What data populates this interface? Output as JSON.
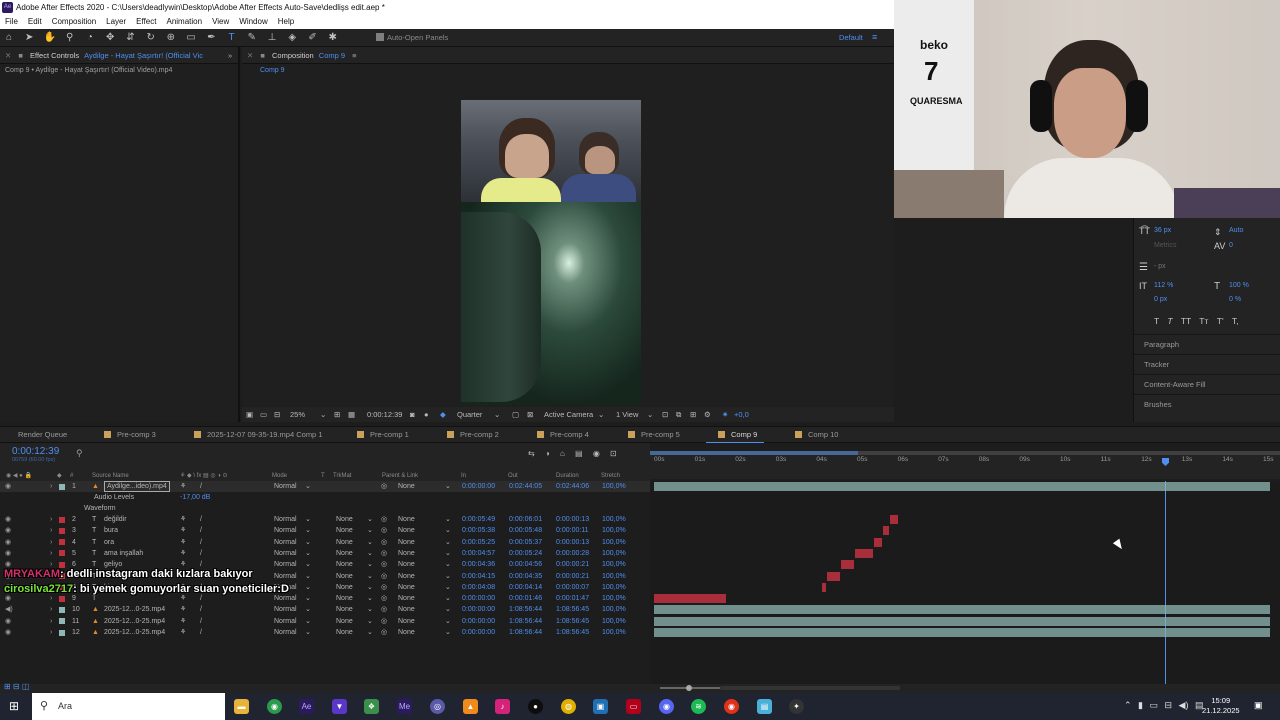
{
  "window": {
    "title": "Adobe After Effects 2020 - C:\\Users\\deadlywin\\Desktop\\Adobe After Effects Auto-Save\\dedlişs edit.aep *"
  },
  "menu": [
    "File",
    "Edit",
    "Composition",
    "Layer",
    "Effect",
    "Animation",
    "View",
    "Window",
    "Help"
  ],
  "toolbar": {
    "auto_open_panels": "Auto-Open Panels",
    "workspace": "Default"
  },
  "effect_controls": {
    "tab_label": "Effect Controls",
    "tab_target": "Aydilge - Hayat Şaşırtır! (Official Vic",
    "subtitle": "Comp 9 • Aydilge - Hayat Şaşırtır! (Official Video).mp4"
  },
  "composition_panel": {
    "tab_label": "Composition",
    "tab_target": "Comp 9",
    "breadcrumb": "Comp 9",
    "zoom": "25%",
    "timecode": "0:00:12:39",
    "resolution": "Quarter",
    "camera": "Active Camera",
    "view": "1 View",
    "exposure": "+0,0"
  },
  "character_panel": {
    "font_size": "36 px",
    "leading": "Auto",
    "kerning": "Metrics",
    "tracking": "0",
    "stroke_width": "- px",
    "vert_scale": "112 %",
    "horiz_scale": "100 %",
    "baseline": "0 px",
    "tsume": "0 %",
    "style_buttons": [
      "T",
      "T",
      "TT",
      "Tт",
      "T'",
      "T,"
    ]
  },
  "side_sections": [
    "Paragraph",
    "Tracker",
    "Content-Aware Fill",
    "Brushes"
  ],
  "timeline_tabs": [
    {
      "label": "Render Queue",
      "color": "#232323"
    },
    {
      "label": "Pre-comp 3",
      "color": "#c9a15a"
    },
    {
      "label": "2025-12-07 09-35-19.mp4 Comp 1",
      "color": "#c9a15a"
    },
    {
      "label": "Pre-comp 1",
      "color": "#c9a15a"
    },
    {
      "label": "Pre-comp 2",
      "color": "#c9a15a"
    },
    {
      "label": "Pre-comp 4",
      "color": "#c9a15a"
    },
    {
      "label": "Pre-comp 5",
      "color": "#c9a15a"
    },
    {
      "label": "Comp 9",
      "color": "#c9a15a"
    },
    {
      "label": "Comp 10",
      "color": "#c9a15a"
    }
  ],
  "timeline": {
    "timecode": "0:00:12:39",
    "timecode_sub": "00759 (60.00 fps)",
    "columns": {
      "num": "#",
      "source_name": "Source Name",
      "mode": "Mode",
      "t": "T",
      "trkmat": "TrkMat",
      "parent": "Parent & Link",
      "in": "In",
      "out": "Out",
      "duration": "Duration",
      "stretch": "Stretch"
    },
    "ruler_labels": [
      "00s",
      "01s",
      "02s",
      "03s",
      "04s",
      "05s",
      "06s",
      "07s",
      "08s",
      "09s",
      "10s",
      "11s",
      "12s",
      "13s",
      "14s",
      "15s"
    ],
    "audio_levels_label": "Audio Levels",
    "audio_levels_value": "-17,00 dB",
    "waveform_label": "Waveform",
    "layers": [
      {
        "num": "1",
        "name": "Aydilge...ideo).mp4",
        "mode": "Normal",
        "trkmat": "",
        "parent": "None",
        "in": "0:00:00:00",
        "out": "0:02:44:05",
        "dur": "0:02:44:06",
        "stretch": "100,0%",
        "color": "#8fb8b4",
        "type": "video"
      },
      {
        "num": "2",
        "name": "değildir",
        "mode": "Normal",
        "trkmat": "None",
        "parent": "None",
        "in": "0:00:05:49",
        "out": "0:00:06:01",
        "dur": "0:00:00:13",
        "stretch": "100,0%",
        "color": "#c0313f",
        "type": "text"
      },
      {
        "num": "3",
        "name": "bura",
        "mode": "Normal",
        "trkmat": "None",
        "parent": "None",
        "in": "0:00:05:38",
        "out": "0:00:05:48",
        "dur": "0:00:00:11",
        "stretch": "100,0%",
        "color": "#c0313f",
        "type": "text"
      },
      {
        "num": "4",
        "name": "ora",
        "mode": "Normal",
        "trkmat": "None",
        "parent": "None",
        "in": "0:00:05:25",
        "out": "0:00:05:37",
        "dur": "0:00:00:13",
        "stretch": "100,0%",
        "color": "#c0313f",
        "type": "text"
      },
      {
        "num": "5",
        "name": "ama inşallah",
        "mode": "Normal",
        "trkmat": "None",
        "parent": "None",
        "in": "0:00:04:57",
        "out": "0:00:05:24",
        "dur": "0:00:00:28",
        "stretch": "100,0%",
        "color": "#c0313f",
        "type": "text"
      },
      {
        "num": "6",
        "name": "geliyo",
        "mode": "Normal",
        "trkmat": "None",
        "parent": "None",
        "in": "0:00:04:36",
        "out": "0:00:04:56",
        "dur": "0:00:00:21",
        "stretch": "100,0%",
        "color": "#c0313f",
        "type": "text"
      },
      {
        "num": "7",
        "name": "",
        "mode": "Normal",
        "trkmat": "None",
        "parent": "None",
        "in": "0:00:04:15",
        "out": "0:00:04:35",
        "dur": "0:00:00:21",
        "stretch": "100,0%",
        "color": "#c0313f",
        "type": "text"
      },
      {
        "num": "8",
        "name": "bir",
        "mode": "Normal",
        "trkmat": "None",
        "parent": "None",
        "in": "0:00:04:08",
        "out": "0:00:04:14",
        "dur": "0:00:00:07",
        "stretch": "100,0%",
        "color": "#c0313f",
        "type": "text"
      },
      {
        "num": "9",
        "name": "",
        "mode": "Normal",
        "trkmat": "None",
        "parent": "None",
        "in": "0:00:00:00",
        "out": "0:00:01:46",
        "dur": "0:00:01:47",
        "stretch": "100,0%",
        "color": "#c0313f",
        "type": "text"
      },
      {
        "num": "10",
        "name": "2025-12...0-25.mp4",
        "mode": "Normal",
        "trkmat": "None",
        "parent": "None",
        "in": "0:00:00:00",
        "out": "1:08:56:44",
        "dur": "1:08:56:45",
        "stretch": "100,0%",
        "color": "#8fb8b4",
        "type": "audio"
      },
      {
        "num": "11",
        "name": "2025-12...0-25.mp4",
        "mode": "Normal",
        "trkmat": "None",
        "parent": "None",
        "in": "0:00:00:00",
        "out": "1:08:56:44",
        "dur": "1:08:56:45",
        "stretch": "100,0%",
        "color": "#8fb8b4",
        "type": "video"
      },
      {
        "num": "12",
        "name": "2025-12...0-25.mp4",
        "mode": "Normal",
        "trkmat": "None",
        "parent": "None",
        "in": "0:00:00:00",
        "out": "1:08:56:44",
        "dur": "1:08:56:45",
        "stretch": "100,0%",
        "color": "#8fb8b4",
        "type": "video"
      }
    ]
  },
  "chat_overlay": [
    {
      "user": "MRYAKAM",
      "text": ": dedli instagram daki kızlara bakıyor"
    },
    {
      "user": "cirosilva2717",
      "text": ": bi yemek gomuyorlar suan yoneticiler:D"
    }
  ],
  "webcam": {
    "jersey_brand": "beko",
    "jersey_number": "7",
    "jersey_name": "QUARESMA"
  },
  "taskbar": {
    "search_placeholder": "Ara",
    "time": "15:09",
    "date": "21.12.2025"
  }
}
